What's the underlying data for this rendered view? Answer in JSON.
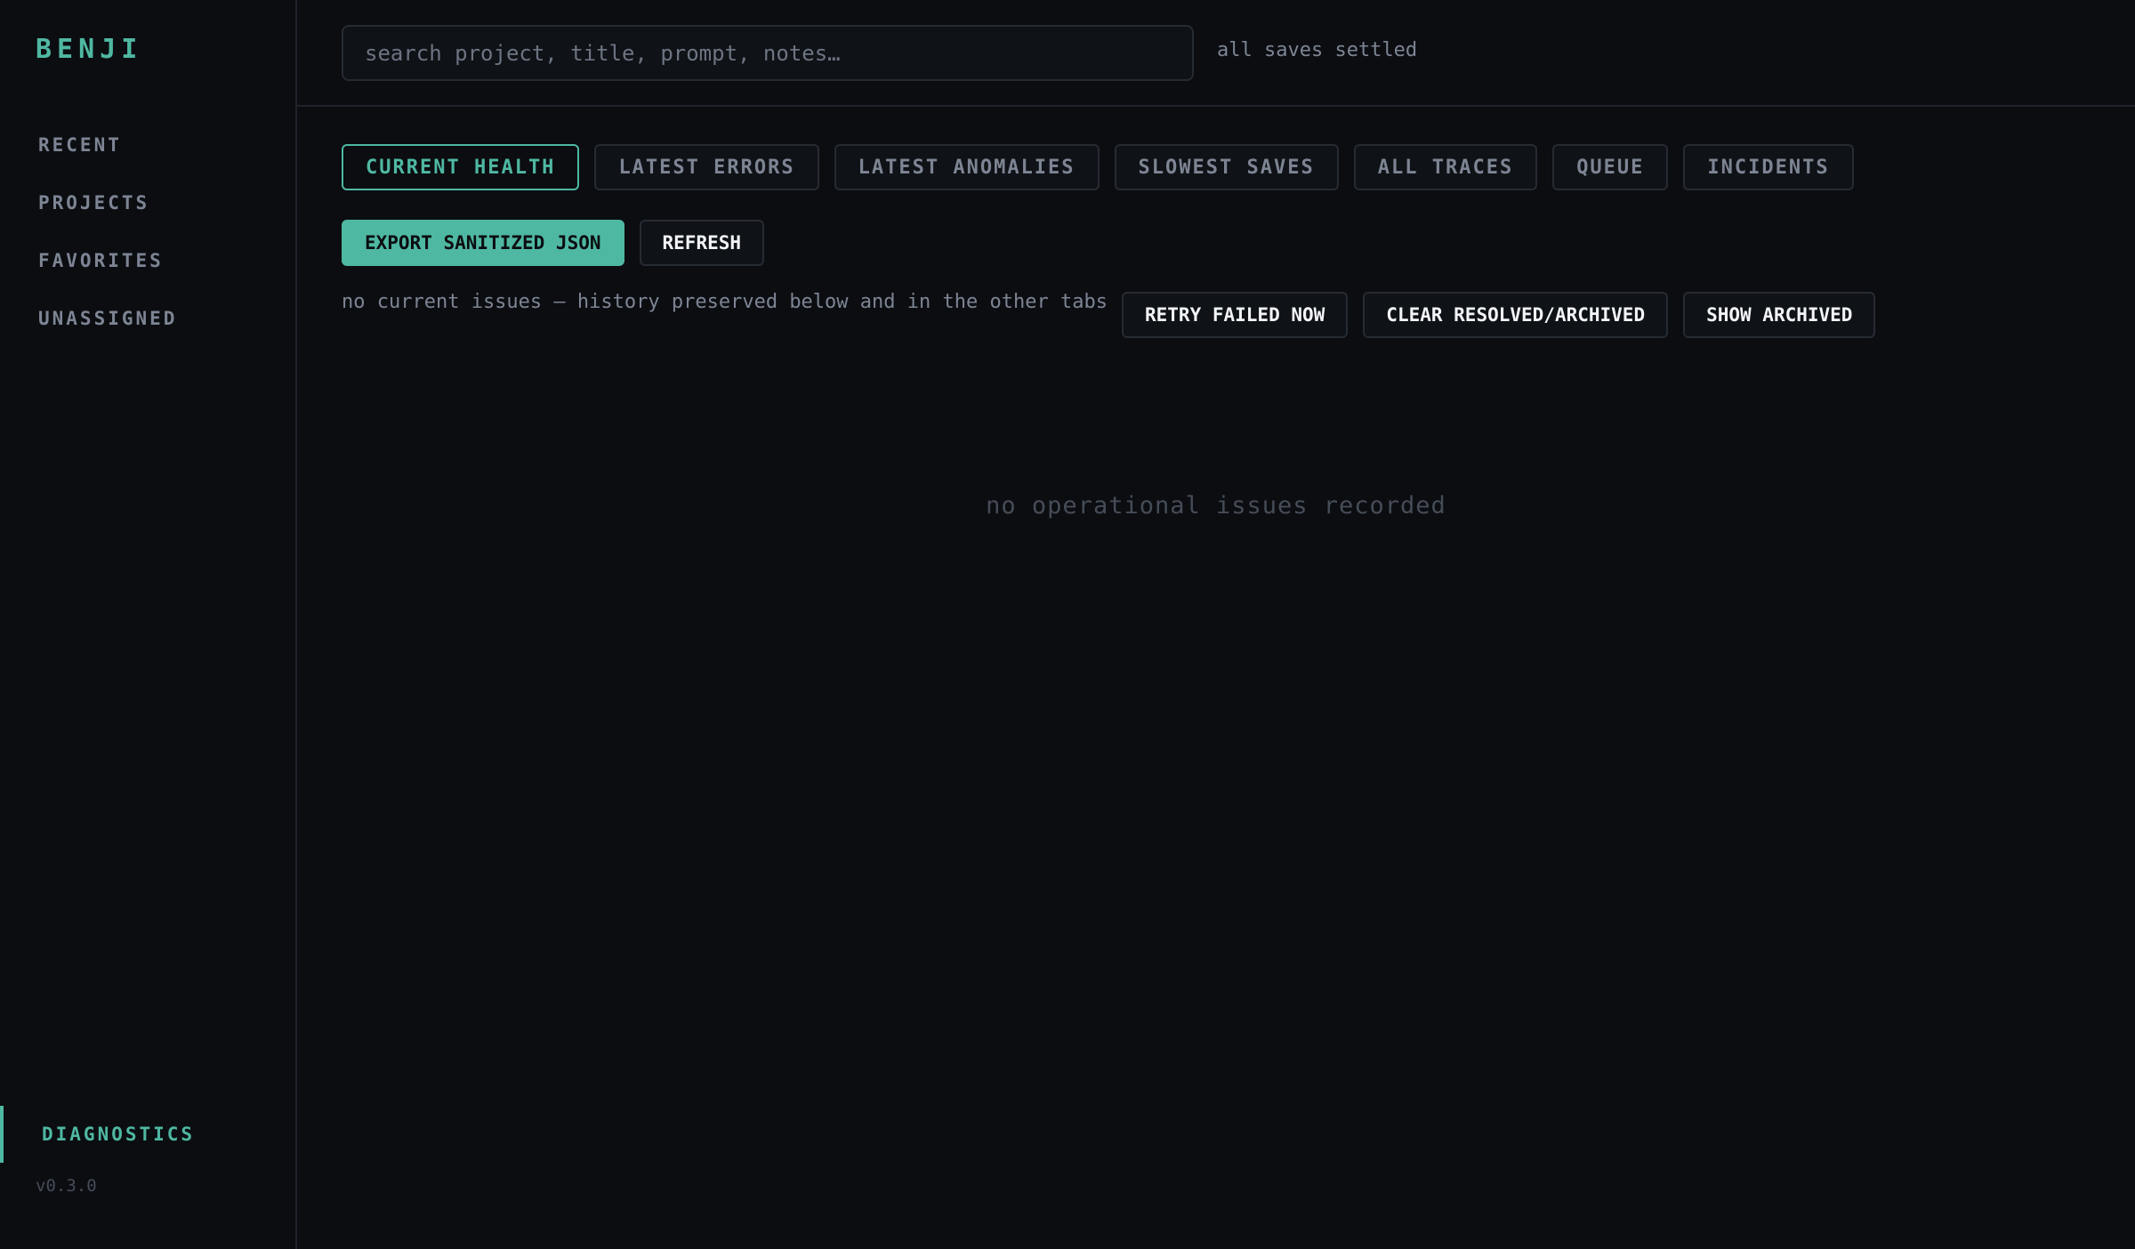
{
  "sidebar": {
    "brand": "BENJI",
    "items": [
      {
        "label": "RECENT"
      },
      {
        "label": "PROJECTS"
      },
      {
        "label": "FAVORITES"
      },
      {
        "label": "UNASSIGNED"
      }
    ],
    "diagnostics_label": "DIAGNOSTICS",
    "version": "v0.3.0"
  },
  "topbar": {
    "search_placeholder": "search project, title, prompt, notes…",
    "search_value": "",
    "save_status": "all saves settled"
  },
  "tabs": [
    {
      "label": "CURRENT HEALTH",
      "active": true
    },
    {
      "label": "LATEST ERRORS"
    },
    {
      "label": "LATEST ANOMALIES"
    },
    {
      "label": "SLOWEST SAVES"
    },
    {
      "label": "ALL TRACES"
    },
    {
      "label": "QUEUE"
    },
    {
      "label": "INCIDENTS"
    }
  ],
  "actions": {
    "export_label": "EXPORT SANITIZED JSON",
    "refresh_label": "REFRESH"
  },
  "status": {
    "message": "no current issues — history preserved below and in the other tabs",
    "retry_label": "RETRY FAILED NOW",
    "clear_label": "CLEAR RESOLVED/ARCHIVED",
    "show_archived_label": "SHOW ARCHIVED"
  },
  "empty_state": "no operational issues recorded",
  "colors": {
    "accent": "#4fb8a2",
    "background": "#0b0d11",
    "muted_text": "#7d8594"
  }
}
